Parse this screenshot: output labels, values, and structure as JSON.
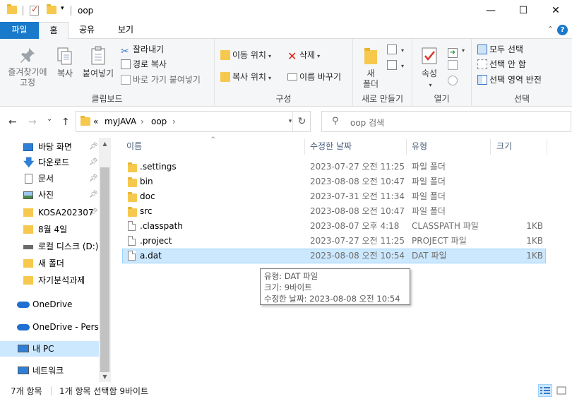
{
  "window": {
    "title": "oop",
    "minimize": "—",
    "maximize": "☐",
    "close": "✕"
  },
  "ribbon_tabs": [
    "파일",
    "홈",
    "공유",
    "보기"
  ],
  "ribbon": {
    "clipboard": {
      "label": "클립보드",
      "pin_quick": [
        "즐겨찾기에",
        "고정"
      ],
      "copy": "복사",
      "paste": "붙여넣기",
      "cut": "잘라내기",
      "copy_path": "경로 복사",
      "paste_shortcut": "바로 가기 붙여넣기"
    },
    "organize": {
      "label": "구성",
      "move_to": "이동 위치",
      "copy_to": "복사 위치",
      "delete": "삭제",
      "rename": "이름 바꾸기"
    },
    "new": {
      "label": "새로 만들기",
      "new_folder": [
        "새",
        "폴더"
      ]
    },
    "open": {
      "label": "열기",
      "properties": "속성"
    },
    "select": {
      "label": "선택",
      "select_all": "모두 선택",
      "select_none": "선택 안 함",
      "invert": "선택 영역 반전"
    }
  },
  "nav": {
    "back": "←",
    "forward": "→",
    "recent": "⌄",
    "up": "↑"
  },
  "address": {
    "overflow": "«",
    "crumbs": [
      "myJAVA",
      "oop"
    ],
    "separator": "›",
    "refresh": "↻"
  },
  "search": {
    "placeholder": "oop 검색"
  },
  "nav_pane": [
    {
      "label": "바탕 화면",
      "icon": "desktop-icon",
      "pinned": true
    },
    {
      "label": "다운로드",
      "icon": "download-icon",
      "pinned": true
    },
    {
      "label": "문서",
      "icon": "document-icon",
      "pinned": true
    },
    {
      "label": "사진",
      "icon": "pictures-icon",
      "pinned": true
    },
    {
      "label": "KOSA202307",
      "icon": "folder-icon",
      "pinned": true
    },
    {
      "label": "8월 4일",
      "icon": "folder-icon",
      "pinned": false
    },
    {
      "label": "로컬 디스크 (D:)",
      "icon": "drive-icon",
      "pinned": false
    },
    {
      "label": "새 폴더",
      "icon": "folder-icon",
      "pinned": false
    },
    {
      "label": "자기분석과제",
      "icon": "folder-icon",
      "pinned": false
    },
    {
      "label": "OneDrive",
      "icon": "onedrive-icon",
      "pinned": false
    },
    {
      "label": "OneDrive - Personal",
      "icon": "onedrive-icon",
      "pinned": false
    },
    {
      "label": "내 PC",
      "icon": "pc-icon",
      "pinned": false
    },
    {
      "label": "네트워크",
      "icon": "network-icon",
      "pinned": false
    }
  ],
  "columns": {
    "name": "이름",
    "date": "수정한 날짜",
    "type": "유형",
    "size": "크기"
  },
  "files": [
    {
      "name": ".settings",
      "date": "2023-07-27 오전 11:25",
      "type": "파일 폴더",
      "size": "",
      "kind": "folder"
    },
    {
      "name": "bin",
      "date": "2023-08-08 오전 10:47",
      "type": "파일 폴더",
      "size": "",
      "kind": "folder"
    },
    {
      "name": "doc",
      "date": "2023-07-31 오전 11:34",
      "type": "파일 폴더",
      "size": "",
      "kind": "folder"
    },
    {
      "name": "src",
      "date": "2023-08-08 오전 10:47",
      "type": "파일 폴더",
      "size": "",
      "kind": "folder"
    },
    {
      "name": ".classpath",
      "date": "2023-08-07 오후 4:18",
      "type": "CLASSPATH 파일",
      "size": "1KB",
      "kind": "file"
    },
    {
      "name": ".project",
      "date": "2023-07-27 오전 11:25",
      "type": "PROJECT 파일",
      "size": "1KB",
      "kind": "file"
    },
    {
      "name": "a.dat",
      "date": "2023-08-08 오전 10:54",
      "type": "DAT 파일",
      "size": "1KB",
      "kind": "file",
      "selected": true
    }
  ],
  "tooltip": {
    "line1": "유형: DAT 파일",
    "line2": "크기: 9바이트",
    "line3": "수정한 날짜: 2023-08-08 오전 10:54"
  },
  "status": {
    "count": "7개 항목",
    "selection": "1개 항목 선택함 9바이트"
  }
}
